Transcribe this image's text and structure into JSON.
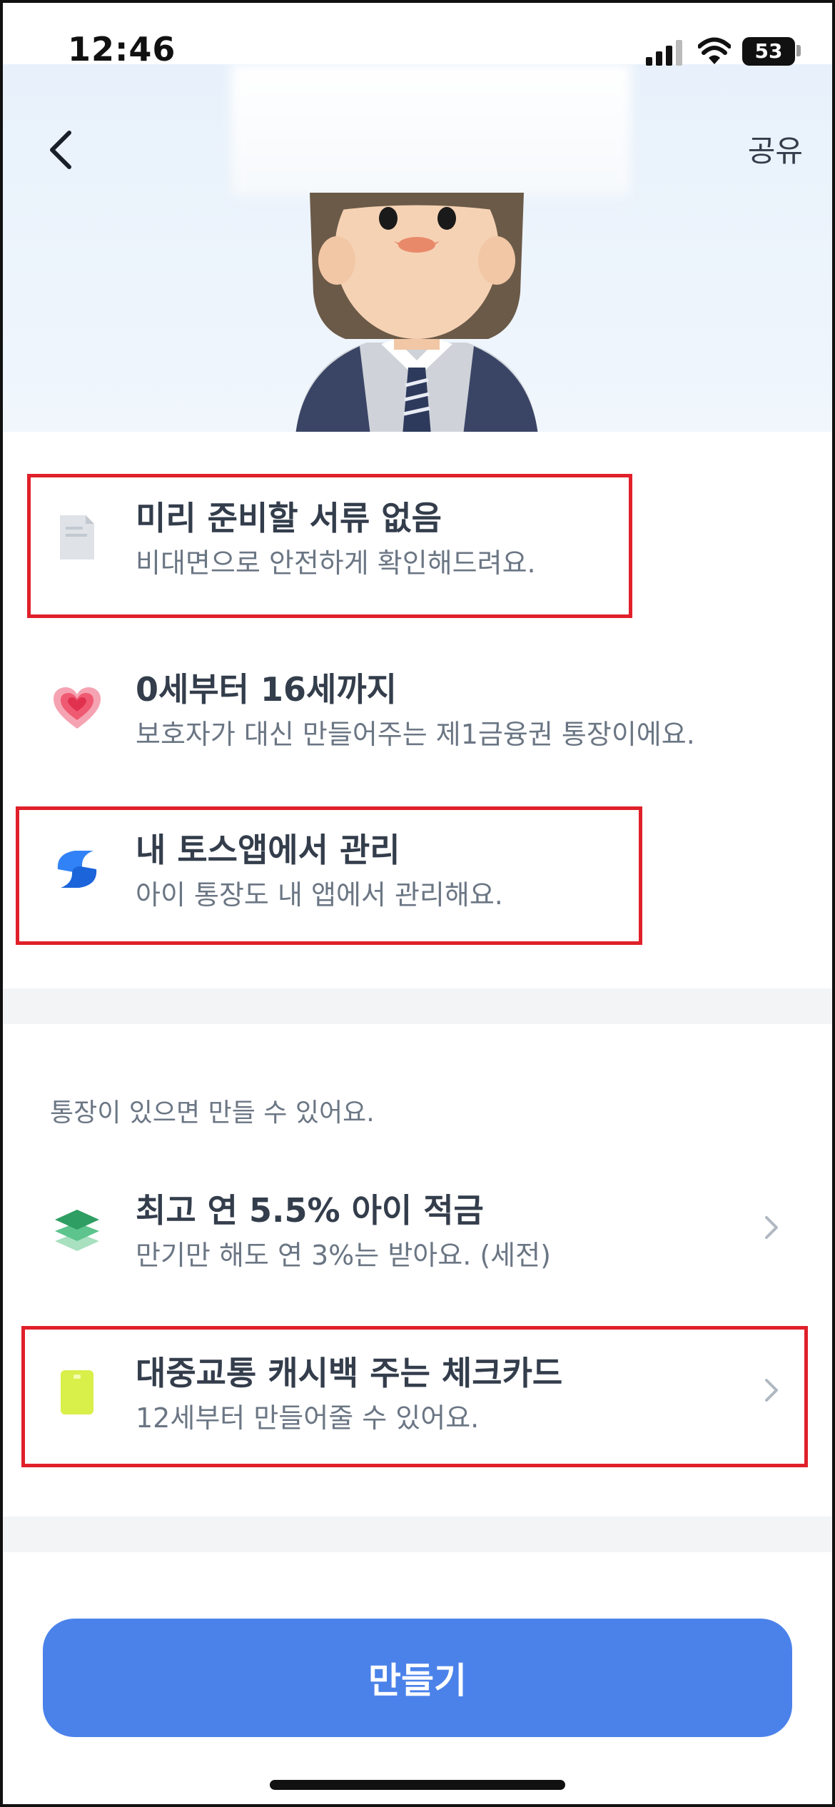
{
  "status": {
    "time": "12:46",
    "battery": "53"
  },
  "header": {
    "share_label": "공유"
  },
  "features": [
    {
      "title": "미리 준비할 서류 없음",
      "desc": "비대면으로 안전하게 확인해드려요."
    },
    {
      "title": "0세부터 16세까지",
      "desc": "보호자가 대신 만들어주는 제1금융권 통장이에요."
    },
    {
      "title": "내 토스앱에서 관리",
      "desc": "아이 통장도 내 앱에서 관리해요."
    }
  ],
  "related": {
    "label": "통장이 있으면 만들 수 있어요.",
    "items": [
      {
        "title": "최고 연 5.5% 아이 적금",
        "desc": "만기만 해도 연 3%는 받아요. (세전)"
      },
      {
        "title": "대중교통 캐시백 주는 체크카드",
        "desc": "12세부터 만들어줄 수 있어요."
      }
    ]
  },
  "cta": {
    "label": "만들기"
  },
  "colors": {
    "accent": "#4b82ea",
    "highlight": "#e0202a",
    "divider": "#f2f4f6"
  }
}
